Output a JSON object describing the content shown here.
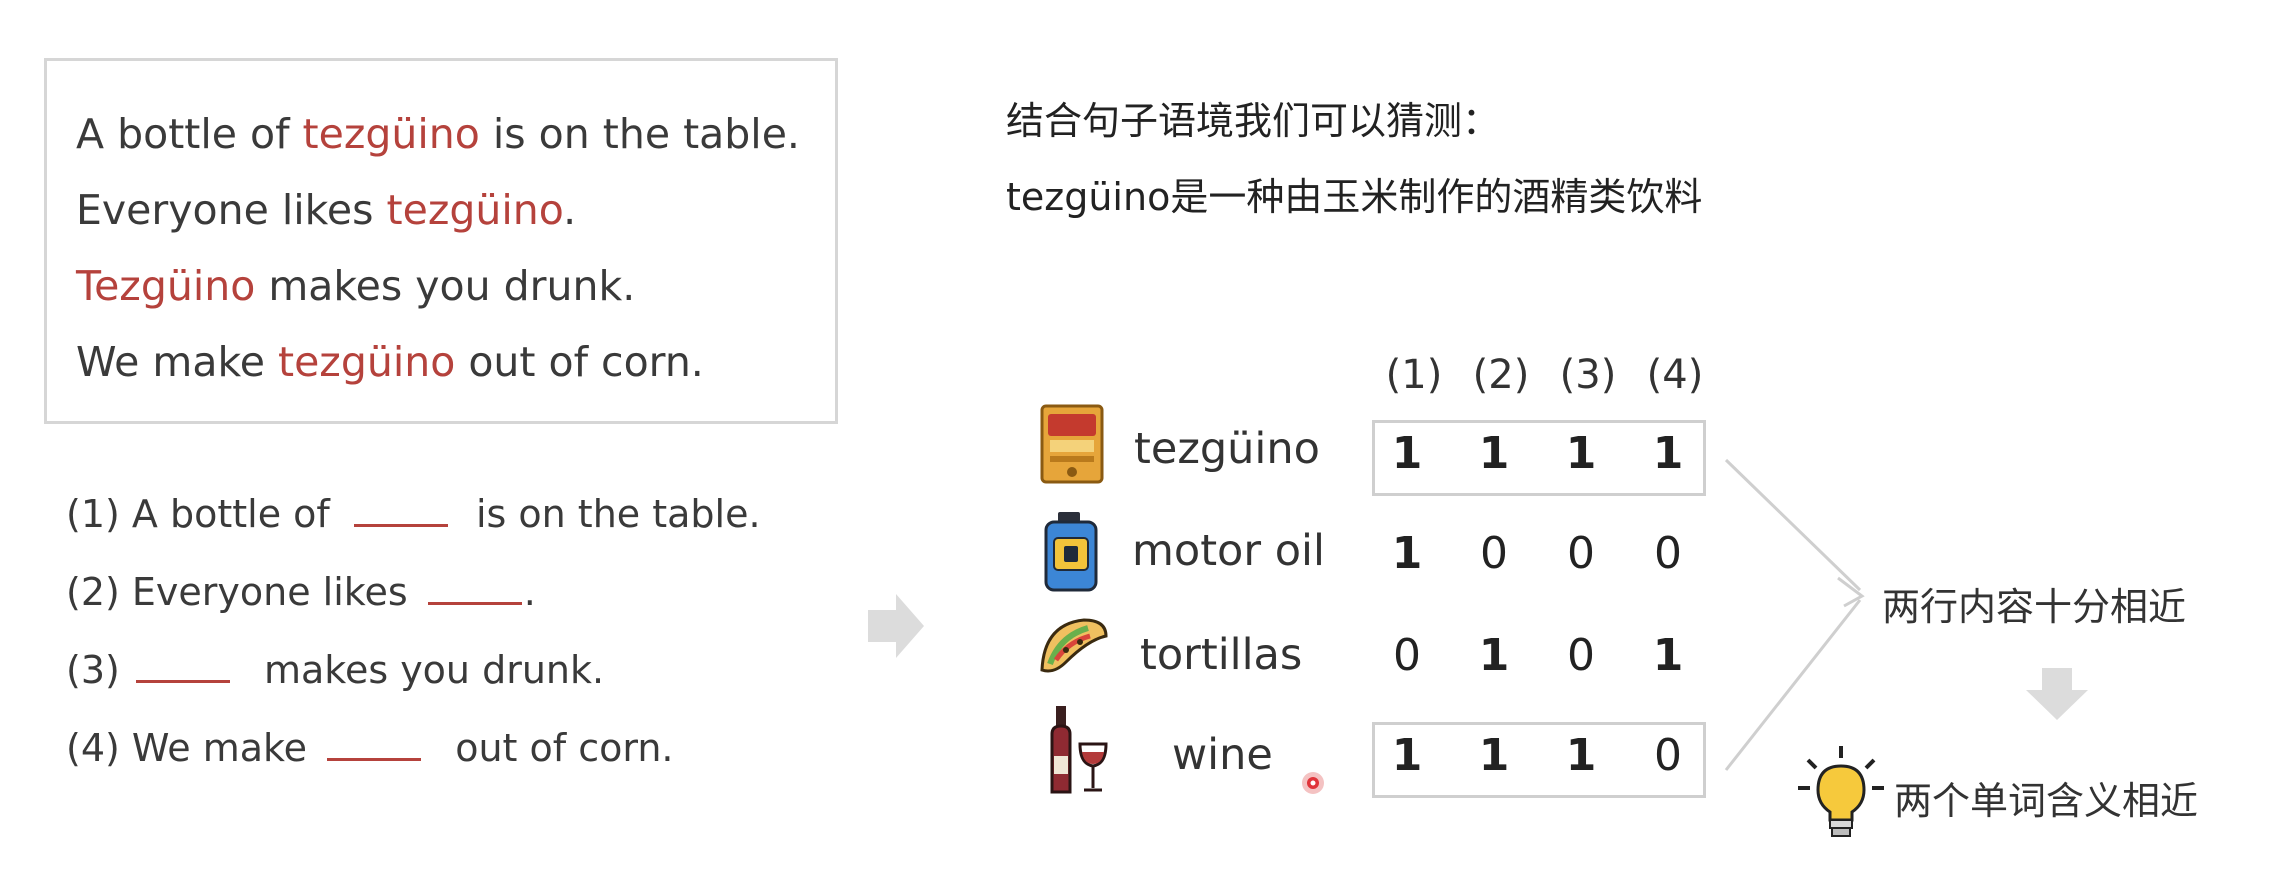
{
  "example": {
    "sentences": [
      {
        "pre": "A bottle of ",
        "word": "tezgüino",
        "post": " is on the table."
      },
      {
        "pre": "Everyone likes ",
        "word": "tezgüino",
        "post": "."
      },
      {
        "pre": "",
        "word": "Tezgüino",
        "post": " makes you drunk."
      },
      {
        "pre": "We make ",
        "word": "tezgüino",
        "post": " out of corn."
      }
    ]
  },
  "blanks": [
    {
      "pre": "(1) A bottle of ",
      "post": " is on the table."
    },
    {
      "pre": "(2) Everyone likes ",
      "post": "."
    },
    {
      "pre": "(3) ",
      "post": " makes you drunk."
    },
    {
      "pre": "(4) We make ",
      "post": " out of corn."
    }
  ],
  "heading": {
    "line1": "结合句子语境我们可以猜测：",
    "line2": "tezgüino是一种由玉米制作的酒精类饮料"
  },
  "matrix": {
    "columns": [
      "(1)",
      "(2)",
      "(3)",
      "(4)"
    ],
    "rows": [
      {
        "word": "tezgüino",
        "icon": "tezguino-bottle-icon",
        "values": [
          "1",
          "1",
          "1",
          "1"
        ]
      },
      {
        "word": "motor oil",
        "icon": "motor-oil-can-icon",
        "values": [
          "1",
          "0",
          "0",
          "0"
        ]
      },
      {
        "word": "tortillas",
        "icon": "taco-icon",
        "values": [
          "0",
          "1",
          "0",
          "1"
        ]
      },
      {
        "word": "wine",
        "icon": "wine-bottle-glass-icon",
        "values": [
          "1",
          "1",
          "1",
          "0"
        ]
      }
    ]
  },
  "notes": {
    "rows_similar": "两行内容十分相近",
    "words_similar": "两个单词含义相近"
  },
  "colors": {
    "highlight": "#b5423c",
    "one_value": "#e98a2c",
    "box_border": "#d6d6d6"
  }
}
